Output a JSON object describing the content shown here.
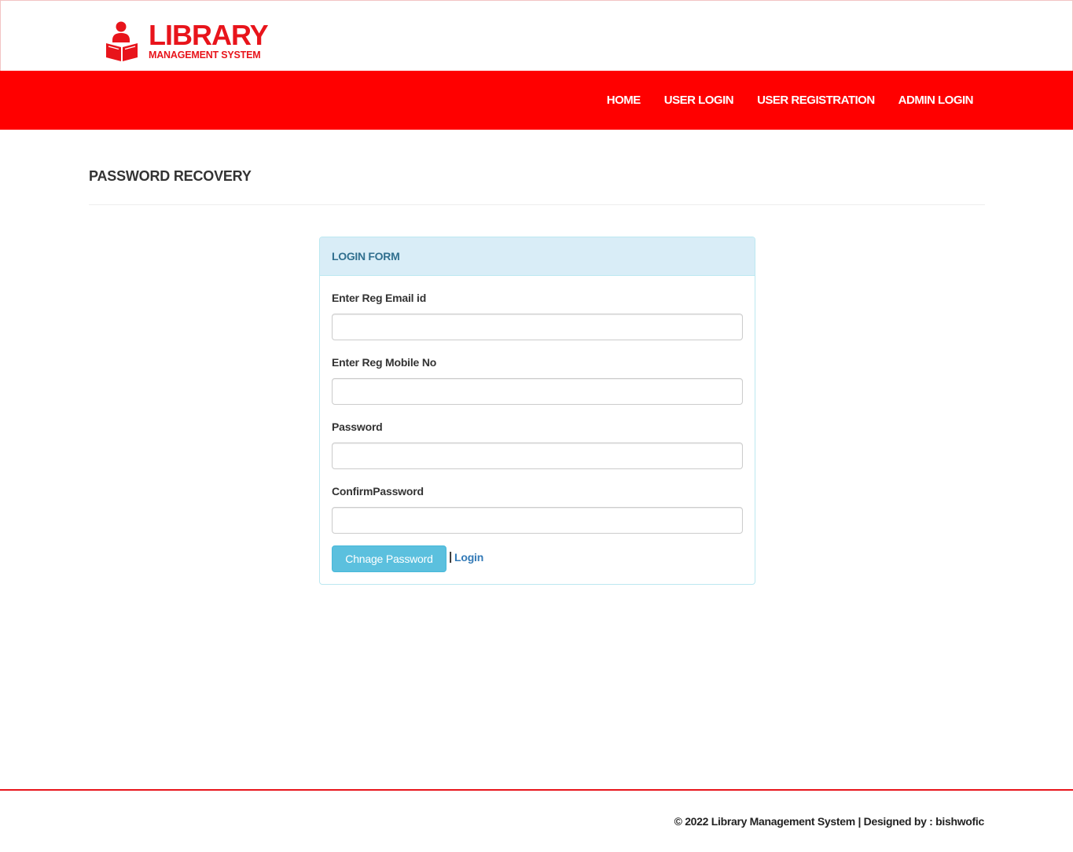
{
  "brand": {
    "title": "LIBRARY",
    "subtitle": "MANAGEMENT SYSTEM",
    "color": "#e8141b",
    "icon": "reader-book-icon"
  },
  "nav": {
    "color": "#ff0000",
    "items": [
      "HOME",
      "USER LOGIN",
      "USER REGISTRATION",
      "ADMIN LOGIN"
    ]
  },
  "page": {
    "title": "PASSWORD RECOVERY"
  },
  "form": {
    "heading": "LOGIN FORM",
    "fields": [
      {
        "label": "Enter Reg Email id",
        "value": ""
      },
      {
        "label": "Enter Reg Mobile No",
        "value": ""
      },
      {
        "label": "Password",
        "value": ""
      },
      {
        "label": "ConfirmPassword",
        "value": ""
      }
    ],
    "submit_label": "Chnage Password",
    "separator": "|",
    "login_link": "Login"
  },
  "footer": {
    "text": "© 2022 Library Management System | Designed by : bishwofic"
  }
}
